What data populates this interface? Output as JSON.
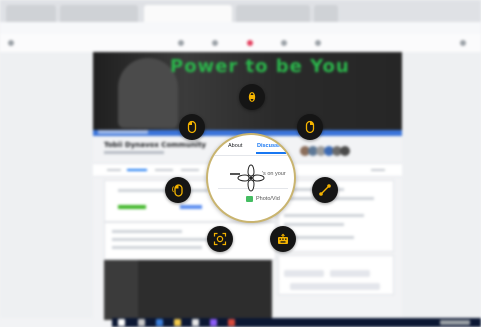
{
  "cover": {
    "title": "Power to be You",
    "title_color": "#2bb54b"
  },
  "lens": {
    "tab_about": "About",
    "tab_discussion": "Discussion",
    "composer_text": "'s on your",
    "photo_text": "Photo/Vid"
  },
  "group": {
    "name": "Tobii Dynavox Community"
  },
  "controls": {
    "scroll_icon": "scroll-updown-icon",
    "left_click_icon": "mouse-left-click-icon",
    "right_click_icon": "mouse-right-click-icon",
    "double_click_icon": "mouse-double-click-icon",
    "drag_icon": "drag-icon",
    "zoom_icon": "zoom-expand-icon",
    "keyboard_icon": "keyboard-icon",
    "move_icon": "move-cross-icon"
  },
  "colors": {
    "accent": "#1877f2",
    "ring_gold": "#c9b46f",
    "cover_bar": "#3b74d9",
    "taskbar": "#0b1733"
  }
}
